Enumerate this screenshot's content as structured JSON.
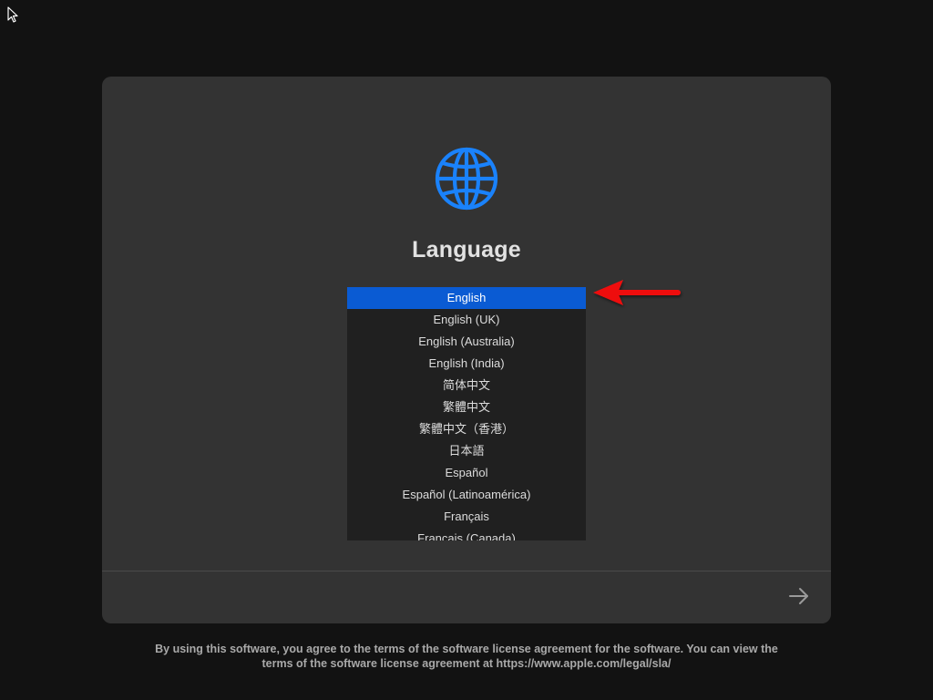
{
  "screen": {
    "title": "Language",
    "icon": "globe-icon",
    "accent_color": "#0a5bd3",
    "languages": [
      {
        "label": "English",
        "selected": true
      },
      {
        "label": "English (UK)",
        "selected": false
      },
      {
        "label": "English (Australia)",
        "selected": false
      },
      {
        "label": "English (India)",
        "selected": false
      },
      {
        "label": "简体中文",
        "selected": false
      },
      {
        "label": "繁體中文",
        "selected": false
      },
      {
        "label": "繁體中文（香港）",
        "selected": false
      },
      {
        "label": "日本語",
        "selected": false
      },
      {
        "label": "Español",
        "selected": false
      },
      {
        "label": "Español (Latinoamérica)",
        "selected": false
      },
      {
        "label": "Français",
        "selected": false
      },
      {
        "label": "Français (Canada)",
        "selected": false
      }
    ],
    "next_button": "arrow-right-icon"
  },
  "annotation": {
    "type": "red-arrow",
    "points_to": "English",
    "color": "#ee1111"
  },
  "footer": {
    "line1": "By using this software, you agree to the terms of the software license agreement for the software. You can view the",
    "line2": "terms of the software license agreement at https://www.apple.com/legal/sla/"
  }
}
